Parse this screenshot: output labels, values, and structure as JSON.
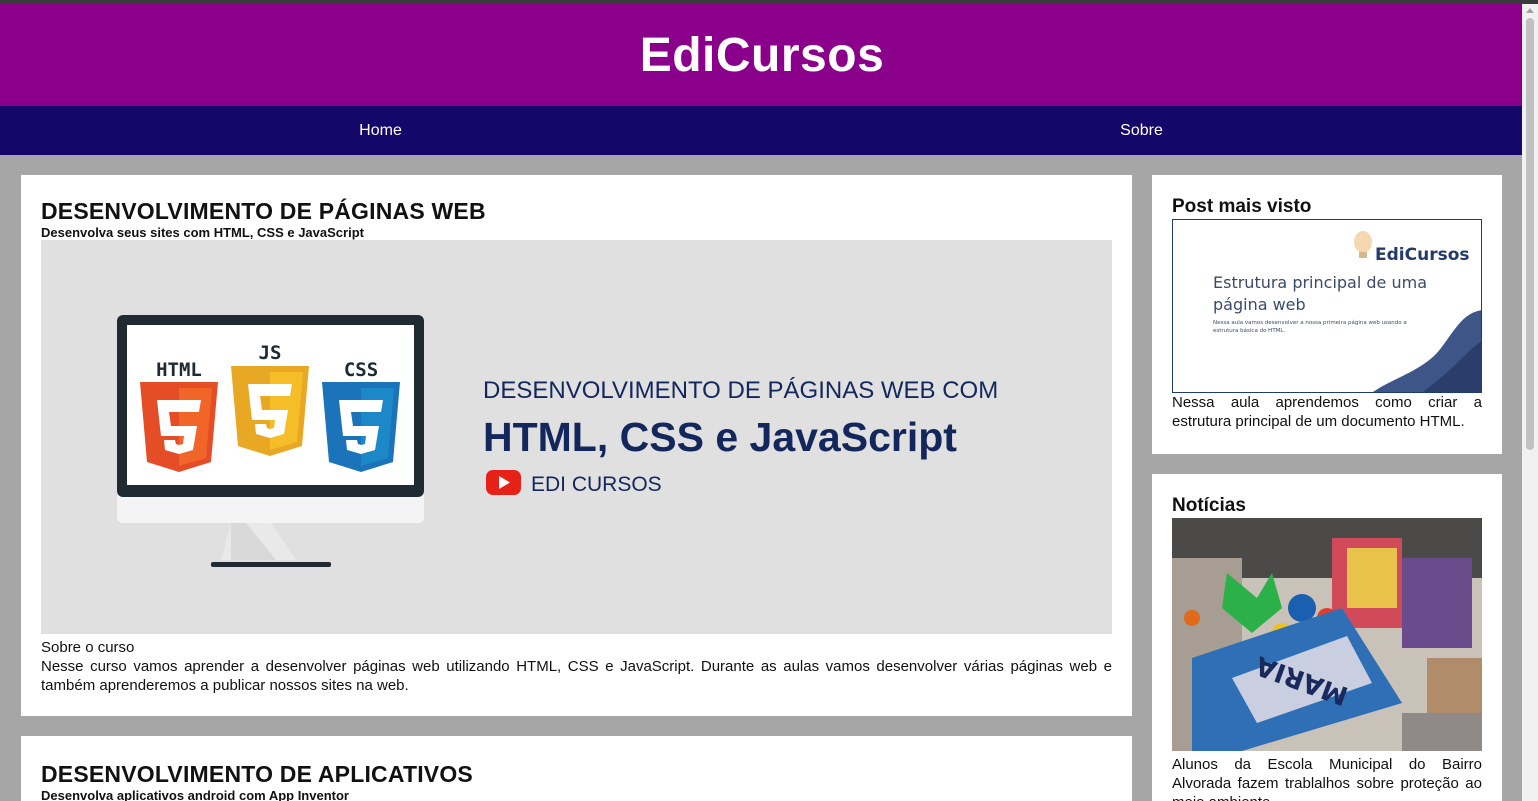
{
  "site": {
    "title": "EdiCursos"
  },
  "nav": {
    "items": [
      {
        "label": "Home"
      },
      {
        "label": "Sobre"
      }
    ]
  },
  "courses": [
    {
      "title": "DESENVOLVIMENTO DE PÁGINAS WEB",
      "subtitle": "Desenvolva seus sites com HTML, CSS e JavaScript",
      "banner": {
        "line1": "DESENVOLVIMENTO DE PÁGINAS WEB COM",
        "line2": "HTML, CSS e JavaScript",
        "brand": "EDI CURSOS",
        "badges": [
          "HTML",
          "JS",
          "CSS"
        ]
      },
      "about_title": "Sobre o curso",
      "about_text": "Nesse curso vamos aprender a desenvolver páginas web utilizando HTML, CSS e JavaScript. Durante as aulas vamos desenvolver várias páginas web e também aprenderemos a publicar nossos sites na web."
    },
    {
      "title": "DESENVOLVIMENTO DE APLICATIVOS",
      "subtitle": "Desenvolva aplicativos android com App Inventor"
    }
  ],
  "sidebar": {
    "popular": {
      "title": "Post mais visto",
      "thumb_brand": "EdiCursos",
      "thumb_title": "Estrutura principal de uma página web",
      "thumb_desc": "Nessa aula vamos desenvolver a nossa primeira página web usando a estrutura básica do HTML.",
      "text": "Nessa aula aprendemos como criar a estrutura principal de um documento HTML."
    },
    "news": {
      "title": "Notícias",
      "photo_label": "MARIA",
      "text": "Alunos da Escola Municipal do Bairro Alvorada fazem trablalhos sobre proteção ao meio ambiente."
    }
  },
  "colors": {
    "header": "#8b008b",
    "nav": "#15076a",
    "background": "#a6a6a6",
    "banner_text": "#14275c"
  }
}
